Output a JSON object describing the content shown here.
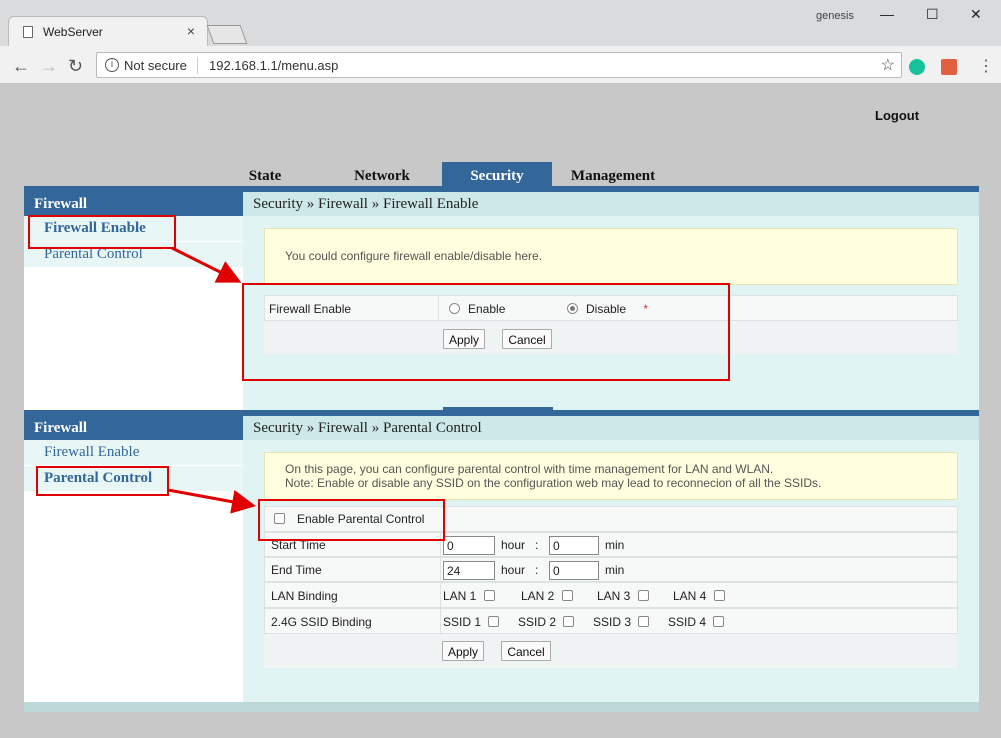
{
  "browser": {
    "tab_title": "WebServer",
    "user": "genesis",
    "security_label": "Not secure",
    "url": "192.168.1.1/menu.asp"
  },
  "header": {
    "logout": "Logout"
  },
  "top_tabs": [
    "State",
    "Network",
    "Security",
    "Management"
  ],
  "panel1": {
    "side_title": "Firewall",
    "side_items": [
      "Firewall Enable",
      "Parental Control"
    ],
    "breadcrumb": "Security » Firewall » Firewall Enable",
    "note": "You could configure firewall enable/disable here.",
    "field_label": "Firewall Enable",
    "option_enable": "Enable",
    "option_disable": "Disable",
    "required_mark": "*",
    "selected": "Disable",
    "apply": "Apply",
    "cancel": "Cancel"
  },
  "panel2": {
    "side_title": "Firewall",
    "side_items": [
      "Firewall Enable",
      "Parental Control"
    ],
    "breadcrumb": "Security » Firewall » Parental Control",
    "note_line1": "On this page, you can configure parental control with time management for LAN and WLAN.",
    "note_label": "Note:",
    "note_line2": "Enable or disable any SSID on the configuration web may lead to reconnecion of all the SSIDs.",
    "enable_label": "Enable Parental Control",
    "start_time_label": "Start Time",
    "end_time_label": "End Time",
    "hour": "hour",
    "min": "min",
    "colon": ":",
    "start_hour": "0",
    "start_min": "0",
    "end_hour": "24",
    "end_min": "0",
    "lan_binding_label": "LAN Binding",
    "lan_options": [
      "LAN 1",
      "LAN 2",
      "LAN 3",
      "LAN 4"
    ],
    "ssid_binding_label": "2.4G SSID Binding",
    "ssid_options": [
      "SSID 1",
      "SSID 2",
      "SSID 3",
      "SSID 4"
    ],
    "apply": "Apply",
    "cancel": "Cancel"
  },
  "colors": {
    "accent": "#336699",
    "annotation": "#e00000",
    "panel_bg": "#e0f4f4"
  }
}
